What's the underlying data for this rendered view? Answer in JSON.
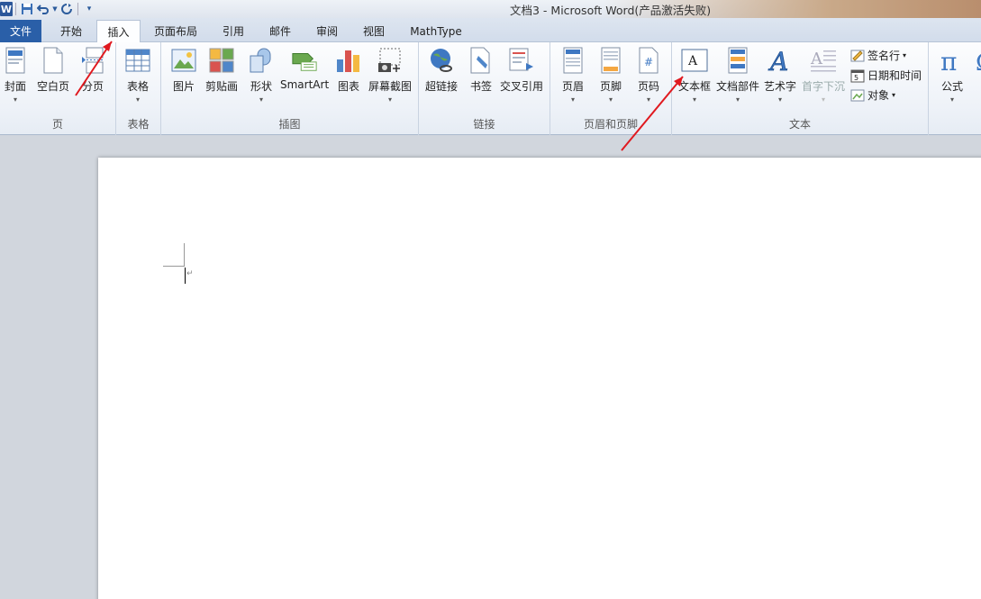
{
  "window": {
    "title": "文档3  -  Microsoft Word(产品激活失败)"
  },
  "qat": {
    "logo": "W"
  },
  "tabs": {
    "file": "文件",
    "items": [
      "开始",
      "插入",
      "页面布局",
      "引用",
      "邮件",
      "审阅",
      "视图",
      "MathType"
    ],
    "active": "插入"
  },
  "ribbon": {
    "groups": {
      "pages": {
        "label": "页",
        "buttons": [
          "封面",
          "空白页",
          "分页"
        ]
      },
      "tables": {
        "label": "表格",
        "buttons": [
          "表格"
        ]
      },
      "illustrations": {
        "label": "插图",
        "buttons": [
          "图片",
          "剪贴画",
          "形状",
          "SmartArt",
          "图表",
          "屏幕截图"
        ]
      },
      "links": {
        "label": "链接",
        "buttons": [
          "超链接",
          "书签",
          "交叉引用"
        ]
      },
      "header_footer": {
        "label": "页眉和页脚",
        "buttons": [
          "页眉",
          "页脚",
          "页码"
        ]
      },
      "text": {
        "label": "文本",
        "buttons": [
          "文本框",
          "文档部件",
          "艺术字",
          "首字下沉"
        ],
        "small": [
          "签名行",
          "日期和时间",
          "对象"
        ]
      },
      "symbols": {
        "buttons": [
          "公式"
        ]
      }
    }
  },
  "colors": {
    "file_tab": "#2a5fa8",
    "annotation_arrow": "#e0191f"
  }
}
